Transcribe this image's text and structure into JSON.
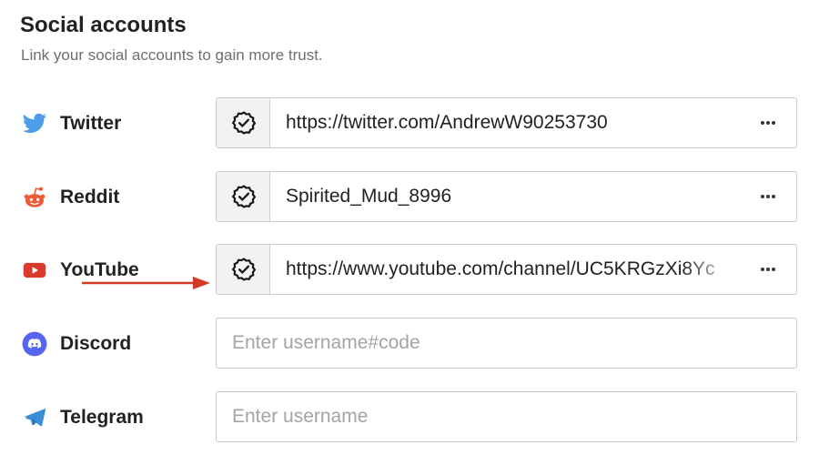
{
  "header": {
    "title": "Social accounts",
    "subtitle": "Link your social accounts to gain more trust."
  },
  "accounts": [
    {
      "platform": "Twitter",
      "icon": "twitter-bird-icon",
      "icon_color": "#4c9ee8",
      "linked": true,
      "value": "https://twitter.com/AndrewW90253730"
    },
    {
      "platform": "Reddit",
      "icon": "reddit-alien-icon",
      "icon_color": "#ee5a36",
      "linked": true,
      "value": "Spirited_Mud_8996"
    },
    {
      "platform": "YouTube",
      "icon": "youtube-play-icon",
      "icon_color": "#d93a2b",
      "linked": true,
      "value": "https://www.youtube.com/channel/UC5KRGzXi8Yc"
    },
    {
      "platform": "Discord",
      "icon": "discord-icon",
      "icon_color": "#5865f2",
      "linked": false,
      "placeholder": "Enter username#code"
    },
    {
      "platform": "Telegram",
      "icon": "telegram-plane-icon",
      "icon_color": "#3a8fd6",
      "linked": false,
      "placeholder": "Enter username"
    }
  ],
  "annotation": {
    "arrow_color": "#d23a25"
  }
}
